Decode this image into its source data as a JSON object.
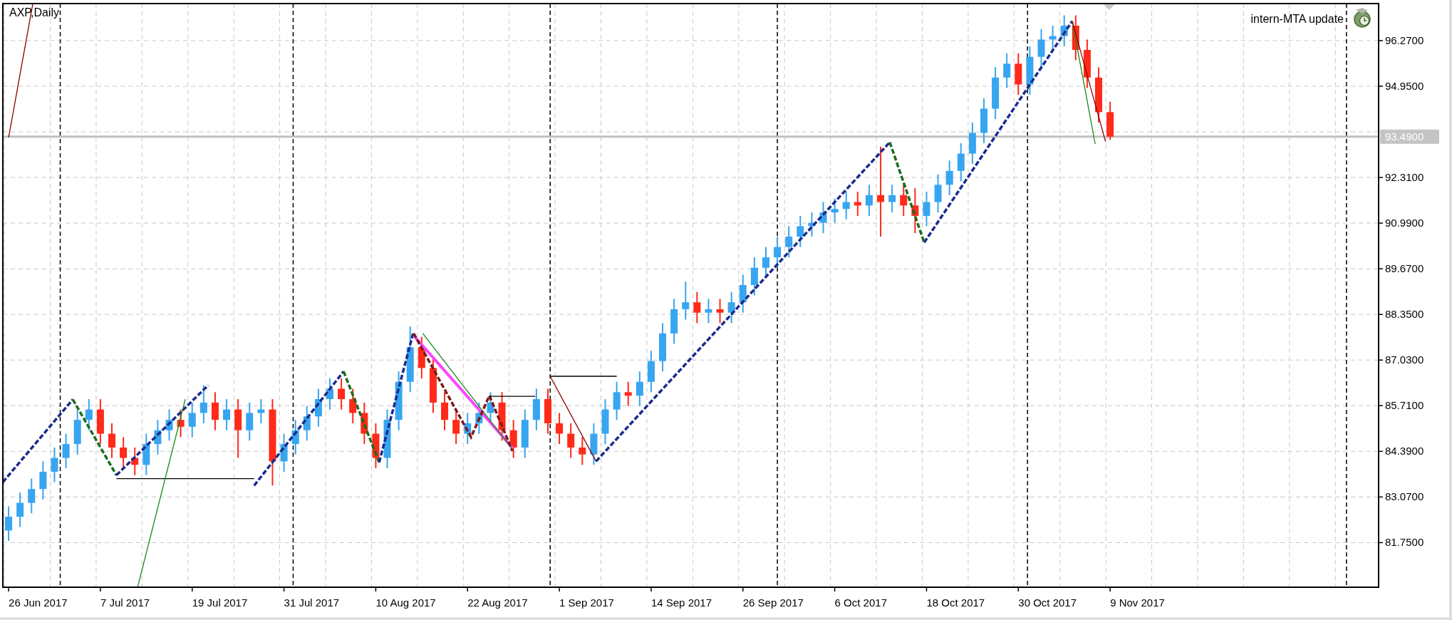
{
  "chart": {
    "title": "AXP,Daily",
    "indicator_label": "intern-MTA update",
    "current_price_label": "93.4900",
    "price_axis_labels": [
      "96.2700",
      "94.9500",
      "92.3100",
      "90.9900",
      "89.6700",
      "88.3500",
      "87.0300",
      "85.7100",
      "84.3900",
      "83.0700",
      "81.7500"
    ],
    "date_axis_labels": [
      "26 Jun 2017",
      "7 Jul 2017",
      "19 Jul 2017",
      "31 Jul 2017",
      "10 Aug 2017",
      "22 Aug 2017",
      "1 Sep 2017",
      "14 Sep 2017",
      "26 Sep 2017",
      "6 Oct 2017",
      "18 Oct 2017",
      "30 Oct 2017",
      "9 Nov 2017"
    ]
  }
}
